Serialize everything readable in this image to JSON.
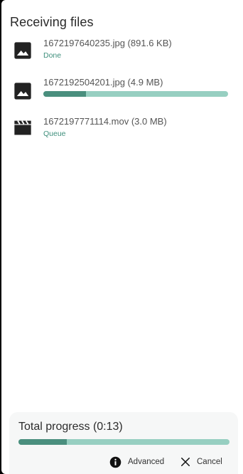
{
  "header": {
    "title": "Receiving files"
  },
  "files": [
    {
      "name_line": "1672197640235.jpg (891.6 KB)",
      "icon": "image-icon",
      "status": "Done",
      "progress": null
    },
    {
      "name_line": "1672192504201.jpg (4.9 MB)",
      "icon": "image-icon",
      "status": null,
      "progress": 0.23
    },
    {
      "name_line": "1672197771114.mov (3.0 MB)",
      "icon": "video-clapperboard-icon",
      "status": "Queue",
      "progress": null
    }
  ],
  "footer": {
    "total_label": "Total progress (0:13)",
    "total_progress": 0.23,
    "advanced_label": "Advanced",
    "cancel_label": "Cancel"
  },
  "colors": {
    "accent": "#4a8f7e",
    "track": "#97cfc1",
    "status_text": "#3f8f7c",
    "panel_bg": "#f6f7f7"
  }
}
